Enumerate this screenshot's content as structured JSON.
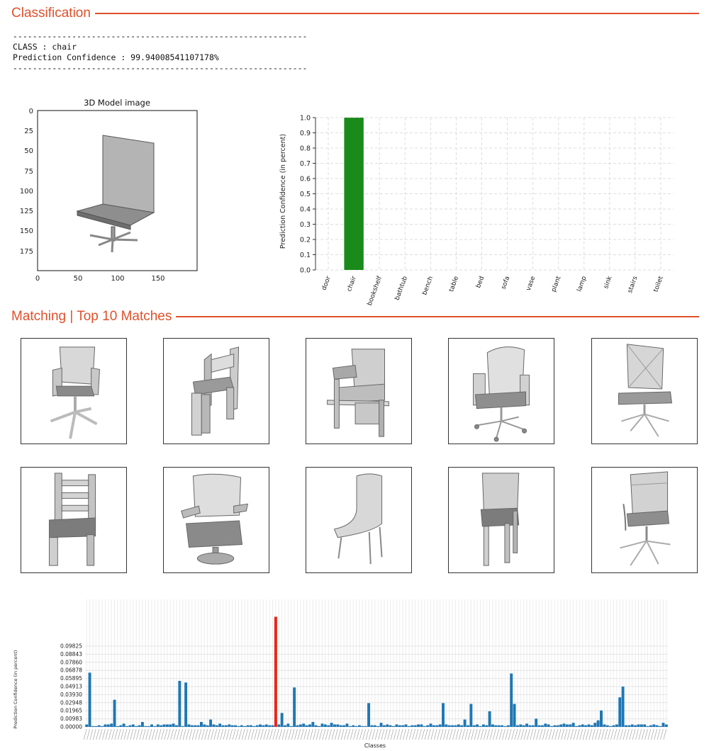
{
  "classification": {
    "section_title": "Classification",
    "console_rule": "------------------------------------------------------------",
    "class_line": "CLASS : chair",
    "confidence_line": "Prediction Confidence : 99.94008541107178%"
  },
  "model_image": {
    "title": "3D Model image",
    "x_ticks": [
      "0",
      "50",
      "100",
      "150"
    ],
    "y_ticks": [
      "0",
      "25",
      "50",
      "75",
      "100",
      "125",
      "150",
      "175"
    ]
  },
  "matching": {
    "section_title": "Matching | Top 10 Matches",
    "thumbnails": [
      {
        "icon": "office-chair-with-arms-icon"
      },
      {
        "icon": "wooden-armchair-icon"
      },
      {
        "icon": "desk-chair-icon"
      },
      {
        "icon": "swivel-office-chair-icon"
      },
      {
        "icon": "mesh-office-chair-icon"
      },
      {
        "icon": "ladder-back-chair-icon"
      },
      {
        "icon": "curved-back-armchair-icon"
      },
      {
        "icon": "lounge-chair-icon"
      },
      {
        "icon": "simple-dining-chair-icon"
      },
      {
        "icon": "executive-office-chair-icon"
      }
    ]
  },
  "chart_data": [
    {
      "type": "bar",
      "categories": [
        "door",
        "chair",
        "bookshelf",
        "bathtub",
        "bench",
        "table",
        "bed",
        "sofa",
        "vase",
        "plant",
        "lamp",
        "sink",
        "stairs",
        "toilet"
      ],
      "values": [
        0.0,
        0.9994,
        0.0,
        0.0,
        0.0,
        0.0,
        0.0,
        0.0,
        0.0,
        0.0,
        0.0,
        0.0,
        0.0,
        0.0
      ],
      "ylabel": "Prediction Confidence (in percent)",
      "ylim": [
        0,
        1.0
      ],
      "y_ticks": [
        "0.0",
        "0.1",
        "0.2",
        "0.3",
        "0.4",
        "0.5",
        "0.6",
        "0.7",
        "0.8",
        "0.9",
        "1.0"
      ],
      "grid": true,
      "colors": {
        "highlight": "#1a8a1a"
      }
    },
    {
      "type": "bar",
      "xlabel": "Classes",
      "ylabel": "Prediction Confidence (in percent)",
      "y_ticks": [
        "0.00000",
        "0.00983",
        "0.01965",
        "0.02948",
        "0.03930",
        "0.04913",
        "0.05895",
        "0.06878",
        "0.07860",
        "0.08843",
        "0.09825"
      ],
      "ylim": [
        0,
        0.09825
      ],
      "highlight_index": 61,
      "highlight_value": 0.134,
      "grid": true,
      "colors": {
        "bars": "#1f77b4",
        "highlight": "#e8261b"
      },
      "values": [
        0.003,
        0.066,
        0.001,
        0.001,
        0.002,
        0.001,
        0.003,
        0.003,
        0.004,
        0.033,
        0.001,
        0.002,
        0.004,
        0.001,
        0.002,
        0.003,
        0.001,
        0.002,
        0.006,
        0.001,
        0.001,
        0.003,
        0.001,
        0.003,
        0.002,
        0.003,
        0.003,
        0.003,
        0.004,
        0.002,
        0.056,
        0.001,
        0.054,
        0.003,
        0.002,
        0.002,
        0.002,
        0.006,
        0.003,
        0.002,
        0.009,
        0.003,
        0.002,
        0.004,
        0.002,
        0.002,
        0.003,
        0.002,
        0.002,
        0.001,
        0.002,
        0.001,
        0.002,
        0.002,
        0.001,
        0.002,
        0.003,
        0.002,
        0.003,
        0.002,
        0.002,
        0.073,
        0.003,
        0.017,
        0.002,
        0.004,
        0.001,
        0.048,
        0.002,
        0.003,
        0.004,
        0.002,
        0.003,
        0.006,
        0.002,
        0.001,
        0.004,
        0.003,
        0.002,
        0.005,
        0.003,
        0.003,
        0.002,
        0.002,
        0.004,
        0.001,
        0.002,
        0.001,
        0.002,
        0.001,
        0.001,
        0.029,
        0.002,
        0.002,
        0.001,
        0.005,
        0.002,
        0.003,
        0.002,
        0.001,
        0.003,
        0.002,
        0.002,
        0.003,
        0.001,
        0.002,
        0.002,
        0.003,
        0.003,
        0.001,
        0.002,
        0.004,
        0.002,
        0.002,
        0.003,
        0.029,
        0.003,
        0.002,
        0.002,
        0.002,
        0.003,
        0.002,
        0.009,
        0.002,
        0.028,
        0.002,
        0.003,
        0.001,
        0.003,
        0.002,
        0.019,
        0.003,
        0.002,
        0.002,
        0.002,
        0.001,
        0.002,
        0.065,
        0.028,
        0.002,
        0.003,
        0.002,
        0.004,
        0.002,
        0.002,
        0.01,
        0.002,
        0.002,
        0.004,
        0.003,
        0.001,
        0.002,
        0.002,
        0.003,
        0.004,
        0.003,
        0.003,
        0.005,
        0.001,
        0.002,
        0.003,
        0.002,
        0.003,
        0.002,
        0.005,
        0.008,
        0.02,
        0.003,
        0.002,
        0.001,
        0.002,
        0.003,
        0.036,
        0.049,
        0.002,
        0.002,
        0.003,
        0.002,
        0.003,
        0.003,
        0.003,
        0.001,
        0.002,
        0.003,
        0.002,
        0.001,
        0.005,
        0.003
      ]
    }
  ]
}
